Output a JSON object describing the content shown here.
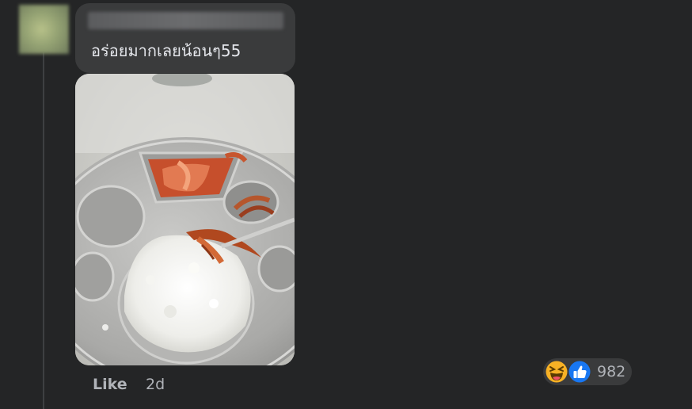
{
  "comment": {
    "author_name": "",
    "text": "อร่อยมากเลยน้อนๆ55",
    "image": {
      "subject": "rice-tray-photo"
    }
  },
  "actions": {
    "like_label": "Like",
    "timestamp": "2d"
  },
  "reactions": {
    "icons": [
      "haha-icon",
      "like-icon"
    ],
    "count": "982"
  },
  "colors": {
    "background": "#242526",
    "bubble": "#3a3b3c",
    "text_primary": "#e4e6eb",
    "text_secondary": "#b0b3b8",
    "like_blue": "#1877f2",
    "haha_yellow": "#f7b125"
  }
}
